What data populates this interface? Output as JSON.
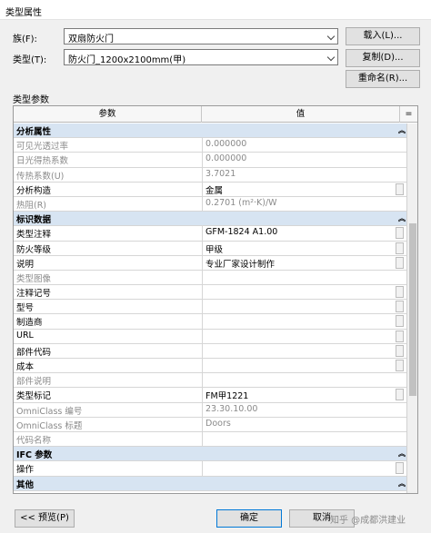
{
  "window": {
    "title": "类型属性"
  },
  "family": {
    "label": "族(F):",
    "value": "双扇防火门",
    "load_button": "载入(L)..."
  },
  "type": {
    "label": "类型(T):",
    "value": "防火门_1200x2100mm(甲)",
    "duplicate_button": "复制(D)...",
    "rename_button": "重命名(R)..."
  },
  "type_params_label": "类型参数",
  "grid": {
    "col_param": "参数",
    "col_value": "值",
    "col_eq": "="
  },
  "groups": [
    {
      "name": "分析属性",
      "rows": [
        {
          "param": "可见光透过率",
          "value": "0.000000",
          "gray": true
        },
        {
          "param": "日光得热系数",
          "value": "0.000000",
          "gray": true
        },
        {
          "param": "传热系数(U)",
          "value": "3.7021",
          "gray": true
        },
        {
          "param": "分析构造",
          "value": "金属",
          "gray": false
        },
        {
          "param": "热阻(R)",
          "value": "0.2701 (m²·K)/W",
          "gray": true
        }
      ]
    },
    {
      "name": "标识数据",
      "rows": [
        {
          "param": "类型注释",
          "value": "GFM-1824 A1.00",
          "gray": false
        },
        {
          "param": "防火等级",
          "value": "甲级",
          "gray": false
        },
        {
          "param": "说明",
          "value": "专业厂家设计制作",
          "gray": false
        },
        {
          "param": "类型图像",
          "value": "",
          "gray": true
        },
        {
          "param": "注释记号",
          "value": "",
          "gray": false
        },
        {
          "param": "型号",
          "value": "",
          "gray": false
        },
        {
          "param": "制造商",
          "value": "",
          "gray": false
        },
        {
          "param": "URL",
          "value": "",
          "gray": false
        },
        {
          "param": "部件代码",
          "value": "",
          "gray": false
        },
        {
          "param": "成本",
          "value": "",
          "gray": false
        },
        {
          "param": "部件说明",
          "value": "",
          "gray": true
        },
        {
          "param": "类型标记",
          "value": "FM甲1221",
          "gray": false
        },
        {
          "param": "OmniClass 编号",
          "value": "23.30.10.00",
          "gray": true
        },
        {
          "param": "OmniClass 标题",
          "value": "Doors",
          "gray": true
        },
        {
          "param": "代码名称",
          "value": "",
          "gray": true
        }
      ]
    },
    {
      "name": "IFC 参数",
      "rows": [
        {
          "param": "操作",
          "value": "",
          "gray": false
        }
      ]
    },
    {
      "name": "其他",
      "rows": []
    }
  ],
  "footer": {
    "preview_button": "<< 预览(P)",
    "ok_button": "确定",
    "cancel_button": "取消"
  },
  "watermark": "知乎 @成都洪建业"
}
